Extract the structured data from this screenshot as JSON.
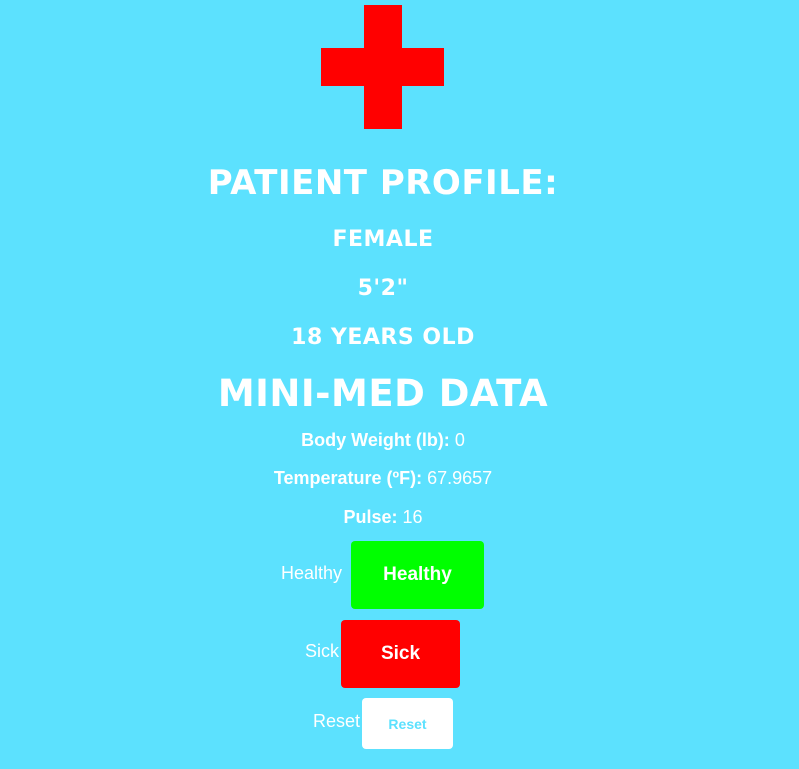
{
  "colors": {
    "background": "#5ce1fe",
    "cross": "#ff0000",
    "healthy": "#00ff00",
    "sick": "#ff0000",
    "reset_bg": "#ffffff",
    "text": "#ffffff"
  },
  "logo": {
    "icon": "medical-cross-icon"
  },
  "profile": {
    "title": "PATIENT PROFILE:",
    "gender": "FEMALE",
    "height": "5'2\"",
    "age": "18 YEARS OLD"
  },
  "data_section": {
    "title": "MINI-MED DATA",
    "weight_label": "Body Weight (lb):",
    "weight_value": "0",
    "temp_label": "Temperature (ºF):",
    "temp_value": "67.9657",
    "pulse_label": "Pulse:",
    "pulse_value": "16"
  },
  "controls": {
    "healthy_label": "Healthy",
    "healthy_button": "Healthy",
    "sick_label": "Sick",
    "sick_button": "Sick",
    "reset_label": "Reset",
    "reset_button": "Reset"
  }
}
